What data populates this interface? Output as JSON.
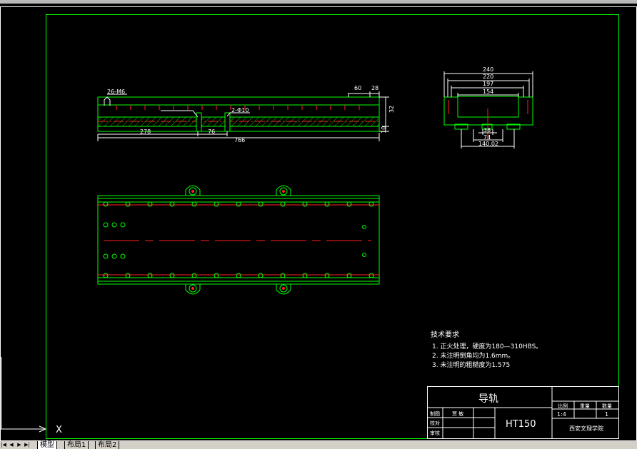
{
  "drawing": {
    "front_view_dims": {
      "thread": "26-M6",
      "hole": "2-Φ10",
      "d60": "60",
      "d28": "28",
      "d278": "278",
      "d76": "76",
      "d766": "766",
      "d32": "32",
      "d10": "10"
    },
    "section_view_dims": {
      "d240": "240",
      "d220": "220",
      "d197": "197",
      "d154": "154",
      "d38": "38",
      "d74": "74",
      "d140": "140.02"
    },
    "tech_requirements": {
      "title": "技术要求",
      "lines": [
        "1. 正火处理，硬度为180—310HBS。",
        "2. 未注明倒角均为1.6mm。",
        "3. 未注明的粗糙度为1.575"
      ]
    },
    "title_block": {
      "part_name": "导轨",
      "material": "HT150",
      "hdr_scale": "比例",
      "hdr_weight": "重量",
      "hdr_qty": "数量",
      "scale": "1:4",
      "quantity": "1",
      "school": "西安文理学院",
      "row_drawn": "制图",
      "drawn_by": "贾 敏",
      "row_checked": "校对",
      "row_approved": "审核"
    },
    "ucs_x": "X"
  },
  "tabs": [
    "模型",
    "布局1",
    "布局2"
  ],
  "nav_buttons": [
    "|◀",
    "◀",
    "▶",
    "▶|"
  ],
  "colors": {
    "border": "#00ff00",
    "frame": "#ffffff",
    "hatch": "#ff3030",
    "center": "#ff2020"
  }
}
